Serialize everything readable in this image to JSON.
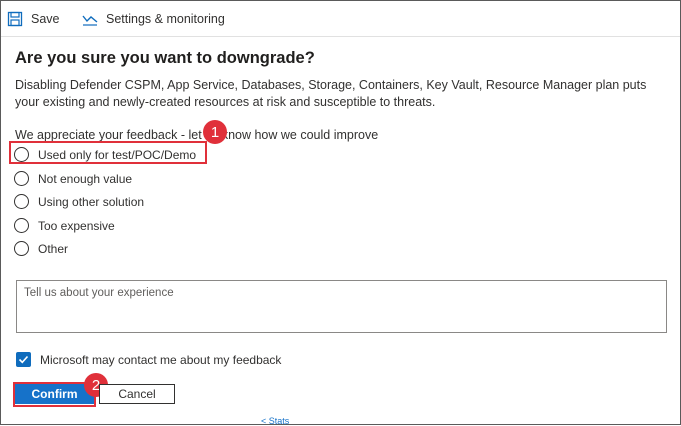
{
  "toolbar": {
    "save_label": "Save",
    "save_icon": "save-icon",
    "settings_label": "Settings & monitoring",
    "settings_icon": "settings-monitoring-icon"
  },
  "dialog": {
    "title": "Are you sure you want to downgrade?",
    "description": "Disabling Defender CSPM, App Service, Databases, Storage, Containers, Key Vault, Resource Manager plan puts your existing and newly-created resources at risk and susceptible to threats.",
    "feedback_prompt": "We appreciate your feedback - let us know how we could improve",
    "options": [
      "Used only for test/POC/Demo",
      "Not enough value",
      "Using other solution",
      "Too expensive",
      "Other"
    ],
    "textarea_placeholder": "Tell us about your experience",
    "contact_checkbox_label": "Microsoft may contact me about my feedback",
    "contact_checked": true,
    "confirm_label": "Confirm",
    "cancel_label": "Cancel"
  },
  "annotations": {
    "step1": "1",
    "step2": "2"
  },
  "cutoff_text": "< Stats",
  "colors": {
    "primary": "#1672c9",
    "annotation": "#e0303a",
    "checkbox": "#0f6cbd"
  }
}
